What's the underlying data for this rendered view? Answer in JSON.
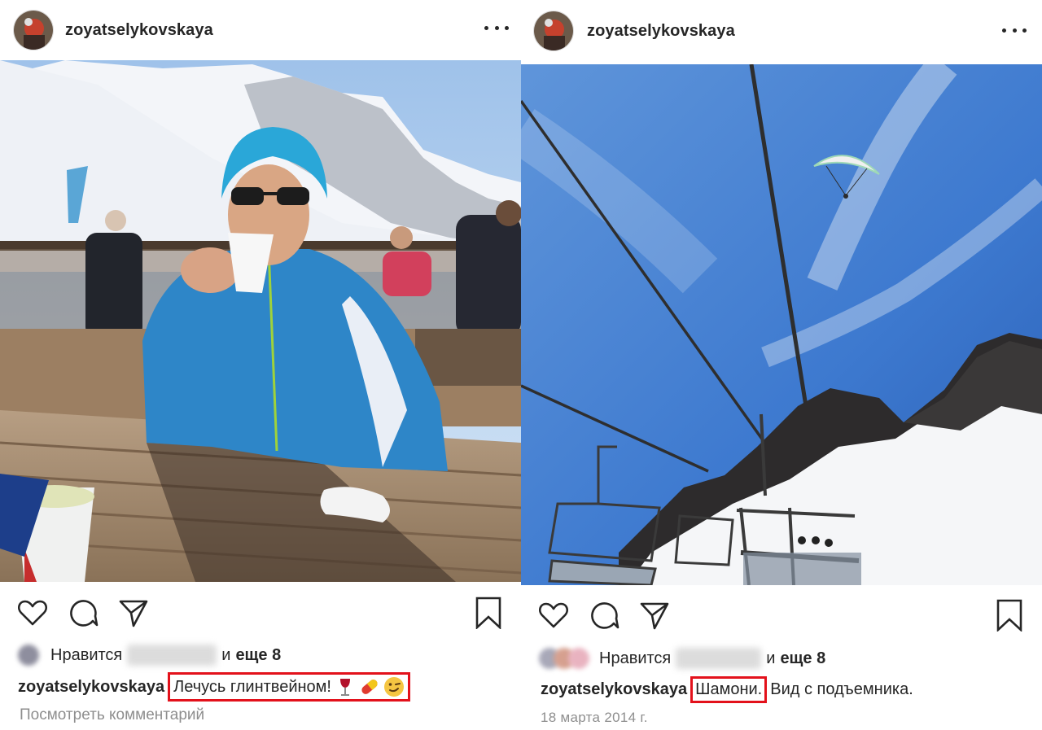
{
  "posts": [
    {
      "username": "zoyatselykovskaya",
      "photo_description": "",
      "likes": {
        "prefix": "Нравится",
        "and": "и",
        "more": "еще 8"
      },
      "caption": {
        "username": "zoyatselykovskaya",
        "highlighted": "Лечусь глинтвейном!",
        "emojis": [
          "wine-glass-emoji",
          "pill-emoji",
          "winking-face-emoji"
        ],
        "rest": ""
      },
      "footer": "Посмотреть комментарий"
    },
    {
      "username": "zoyatselykovskaya",
      "photo_description": "",
      "likes": {
        "prefix": "Нравится",
        "and": "и",
        "more": "еще 8"
      },
      "caption": {
        "username": "zoyatselykovskaya",
        "highlighted": "Шамони.",
        "rest": "Вид с подъемника."
      },
      "footer": "18 марта 2014 г."
    }
  ],
  "icons": [
    "more-options-icon",
    "heart-icon",
    "comment-icon",
    "share-icon",
    "bookmark-icon"
  ],
  "colors": {
    "highlight_border": "#e3111b",
    "text": "#262626",
    "muted": "#8e8e8e",
    "sky": "#3f7fd0"
  }
}
